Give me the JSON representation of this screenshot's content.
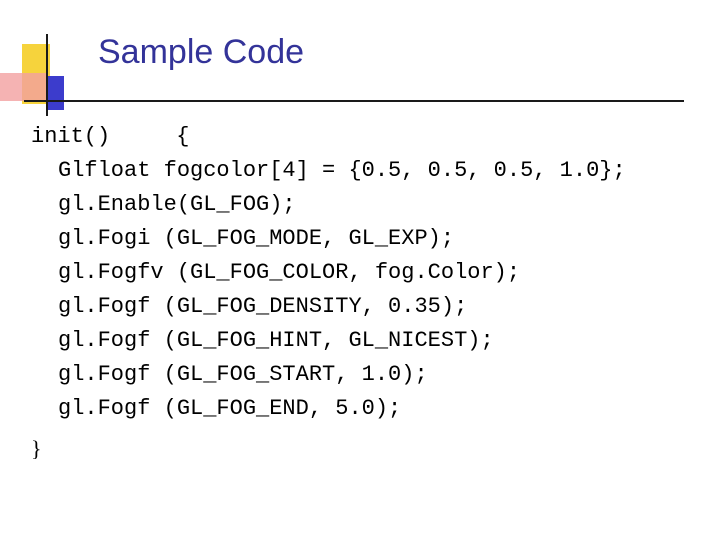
{
  "slide": {
    "title": "Sample Code",
    "code": {
      "header": "init()     {",
      "lines": [
        "Glfloat fogcolor[4] = {0.5, 0.5, 0.5, 1.0};",
        "gl.Enable(GL_FOG);",
        "gl.Fogi (GL_FOG_MODE, GL_EXP);",
        "gl.Fogfv (GL_FOG_COLOR, fog.Color);",
        "gl.Fogf (GL_FOG_DENSITY, 0.35);",
        "gl.Fogf (GL_FOG_HINT, GL_NICEST);",
        "gl.Fogf (GL_FOG_START, 1.0);",
        "gl.Fogf (GL_FOG_END, 5.0);"
      ],
      "footer": "}"
    }
  }
}
